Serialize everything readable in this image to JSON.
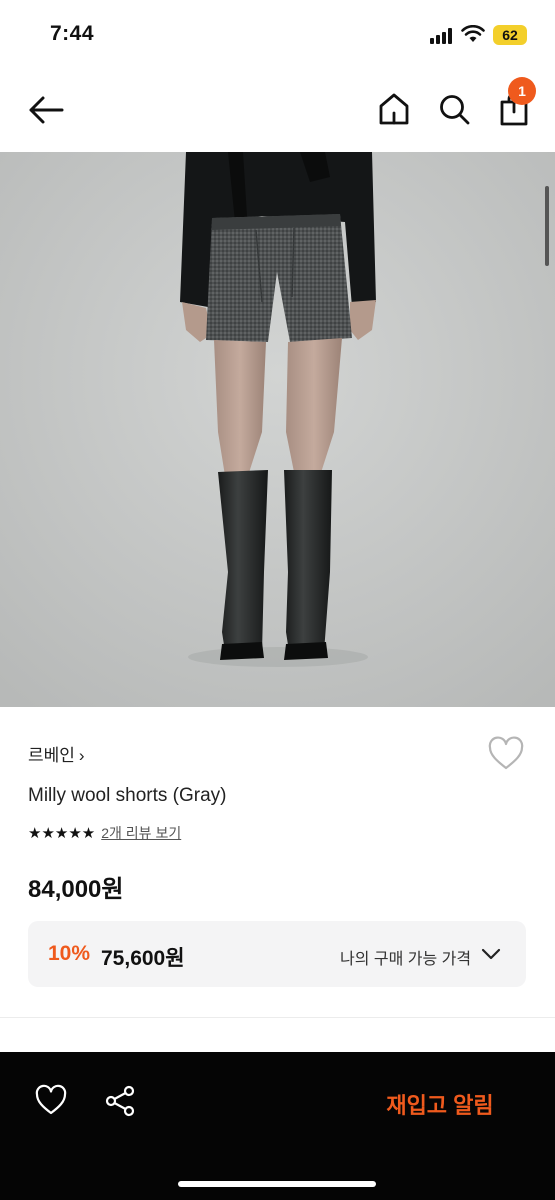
{
  "status_bar": {
    "time": "7:44",
    "battery": "62"
  },
  "nav": {
    "back_icon": "arrow-left-icon",
    "home_icon": "home-icon",
    "search_icon": "search-icon",
    "bag_icon": "shopping-bag-icon",
    "cart_badge": "1"
  },
  "product": {
    "image_alt": "gray wool shorts worn with black top and black knee-high boots",
    "brand": "르베인",
    "brand_chevron": "›",
    "name": "Milly wool shorts (Gray)",
    "stars": "★★★★★",
    "rating": 5,
    "review_link": "2개 리뷰 보기",
    "price": "84,000원",
    "discount": {
      "rate": "10%",
      "price": "75,600원",
      "label": "나의 구매 가능 가격"
    }
  },
  "bottom_bar": {
    "wishlist_icon": "heart-icon",
    "share_icon": "share-icon",
    "restock_label": "재입고 알림"
  },
  "colors": {
    "accent": "#ef5a1d",
    "battery": "#f3cf2b",
    "bottom_bar": "#050505",
    "discount_bg": "#f4f4f5"
  }
}
